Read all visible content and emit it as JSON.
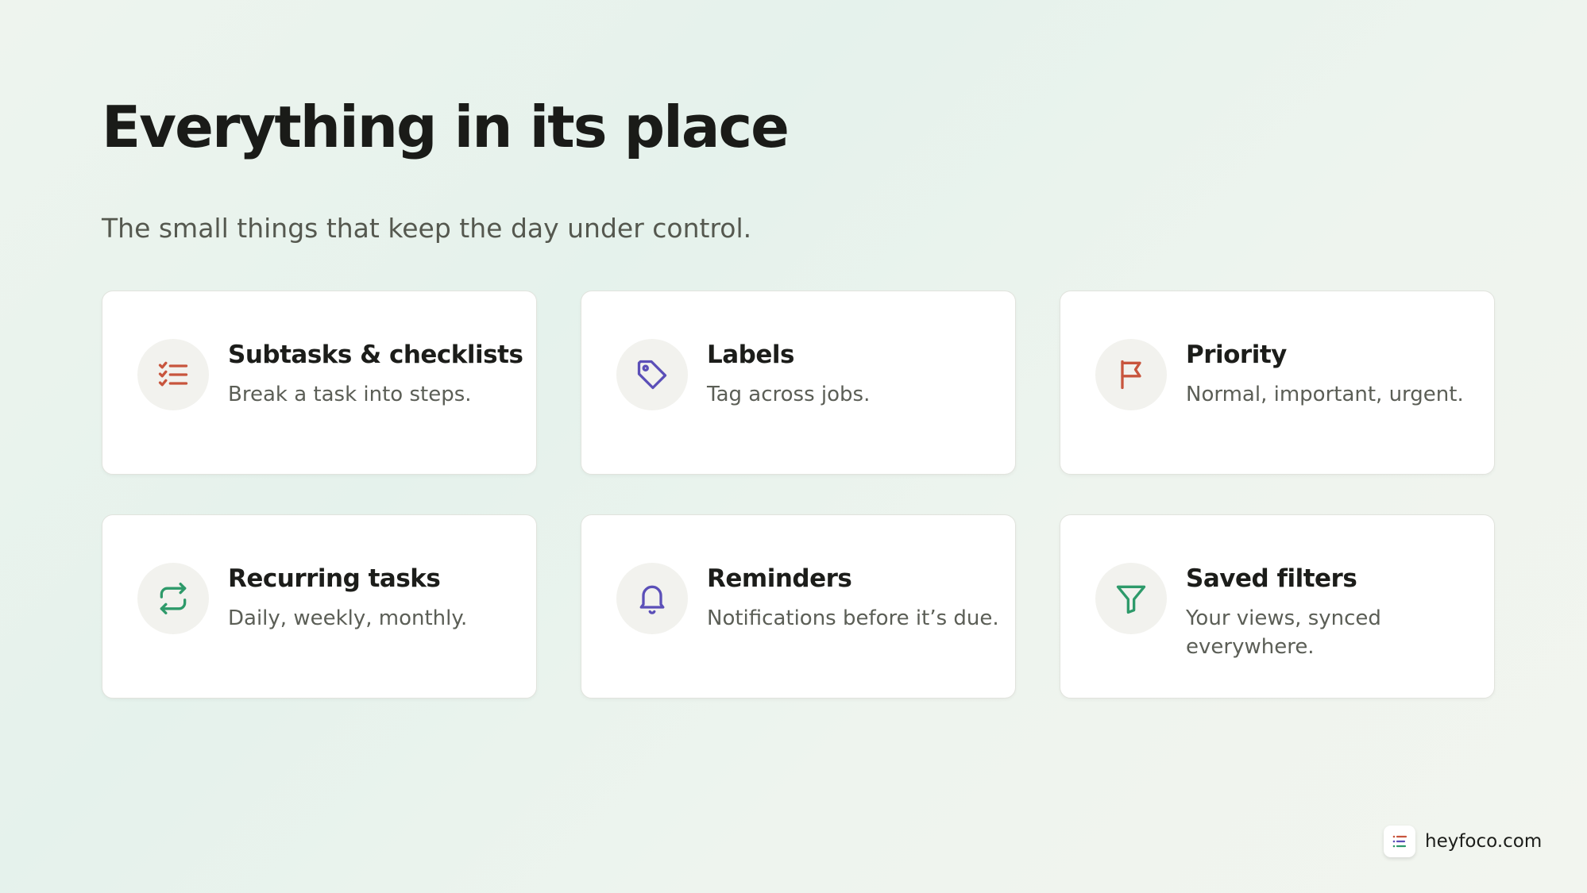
{
  "header": {
    "title": "Everything in its place",
    "subtitle": "The small things that keep the day under control."
  },
  "features": [
    {
      "icon": "checklist-icon",
      "color": "#c8553d",
      "title": "Subtasks & checklists",
      "description": "Break a task into steps."
    },
    {
      "icon": "tag-icon",
      "color": "#5b4fb8",
      "title": "Labels",
      "description": "Tag across jobs."
    },
    {
      "icon": "flag-icon",
      "color": "#c8553d",
      "title": "Priority",
      "description": "Normal, important, urgent."
    },
    {
      "icon": "repeat-icon",
      "color": "#2e9a6a",
      "title": "Recurring tasks",
      "description": "Daily, weekly, monthly."
    },
    {
      "icon": "bell-icon",
      "color": "#5b4fb8",
      "title": "Reminders",
      "description": "Notifications before it’s due."
    },
    {
      "icon": "filter-icon",
      "color": "#2e9a6a",
      "title": "Saved filters",
      "description": "Your views, synced everywhere."
    }
  ],
  "footer": {
    "logo_icon": "list-logo-icon",
    "brand_url": "heyfoco.com"
  }
}
